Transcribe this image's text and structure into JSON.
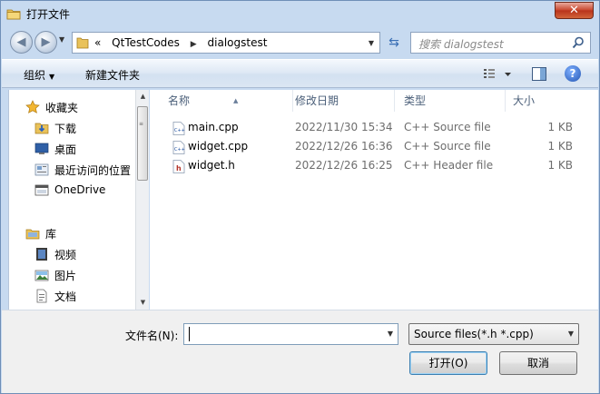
{
  "window": {
    "title": "打开文件",
    "close_label": "✕"
  },
  "address": {
    "crumbs": [
      "«",
      "QtTestCodes",
      "dialogstest"
    ],
    "search_placeholder": "搜索 dialogstest"
  },
  "toolbar": {
    "organize": "组织",
    "new_folder": "新建文件夹",
    "help": "?"
  },
  "nav": {
    "items": [
      {
        "label": "收藏夹",
        "icon": "star-icon"
      },
      {
        "label": "下载",
        "icon": "download-folder-icon"
      },
      {
        "label": "桌面",
        "icon": "desktop-icon"
      },
      {
        "label": "最近访问的位置",
        "icon": "recent-places-icon"
      },
      {
        "label": "OneDrive",
        "icon": "onedrive-icon"
      },
      {
        "label": "库",
        "icon": "library-icon"
      },
      {
        "label": "视频",
        "icon": "video-icon"
      },
      {
        "label": "图片",
        "icon": "pictures-icon"
      },
      {
        "label": "文档",
        "icon": "documents-icon"
      }
    ]
  },
  "columns": {
    "name": "名称",
    "date": "修改日期",
    "type": "类型",
    "size": "大小"
  },
  "files": [
    {
      "name": "main.cpp",
      "date": "2022/11/30 15:34",
      "type": "C++ Source file",
      "size": "1 KB",
      "icon": "cpp-file-icon"
    },
    {
      "name": "widget.cpp",
      "date": "2022/12/26 16:36",
      "type": "C++ Source file",
      "size": "1 KB",
      "icon": "cpp-file-icon"
    },
    {
      "name": "widget.h",
      "date": "2022/12/26 16:25",
      "type": "C++ Header file",
      "size": "1 KB",
      "icon": "header-file-icon"
    }
  ],
  "bottom": {
    "filename_label": "文件名(N):",
    "filename_value": "",
    "filter_value": "Source files(*.h *.cpp)",
    "open_label": "打开(O)",
    "cancel_label": "取消"
  }
}
